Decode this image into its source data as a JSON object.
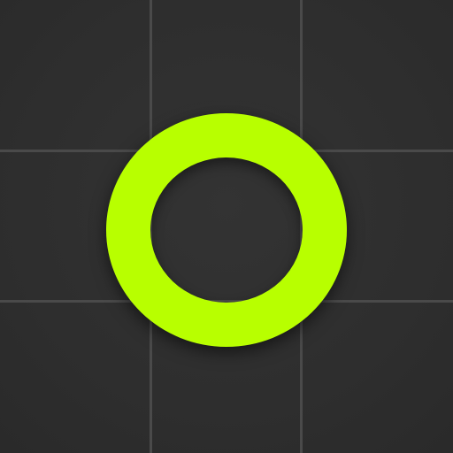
{
  "icon": {
    "glyph": "O",
    "accent_color": "#b8ff00",
    "background_color": "#2f2f2f",
    "grid_line_color": "#4a4a4a"
  }
}
